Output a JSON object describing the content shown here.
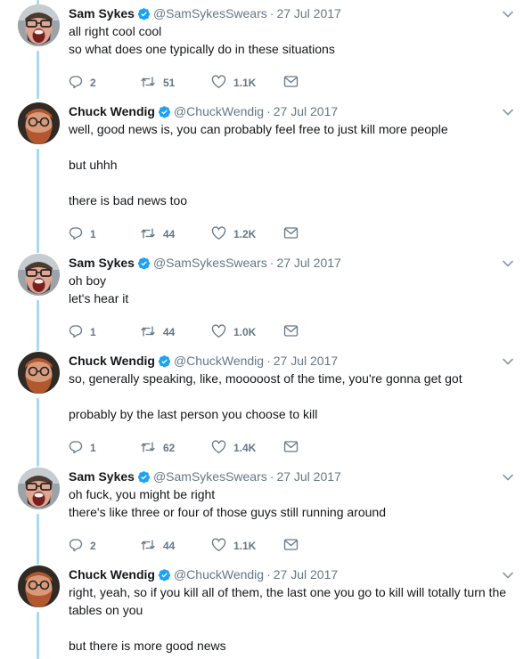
{
  "tweets": [
    {
      "name": "Sam Sykes",
      "handle": "@SamSykesSwears",
      "date": "27 Jul 2017",
      "avatar": "sam-avatar",
      "lines": [
        "all right cool cool",
        "so what does one typically do in these situations"
      ],
      "replies": "2",
      "retweets": "51",
      "likes": "1.1K"
    },
    {
      "name": "Chuck Wendig",
      "handle": "@ChuckWendig",
      "date": "27 Jul 2017",
      "avatar": "chuck-avatar",
      "lines": [
        "well, good news is, you can probably feel free to just kill more people",
        "",
        "but uhhh",
        "",
        "there is bad news too"
      ],
      "replies": "1",
      "retweets": "44",
      "likes": "1.2K"
    },
    {
      "name": "Sam Sykes",
      "handle": "@SamSykesSwears",
      "date": "27 Jul 2017",
      "avatar": "sam-avatar",
      "lines": [
        "oh boy",
        "let's hear it"
      ],
      "replies": "1",
      "retweets": "44",
      "likes": "1.0K"
    },
    {
      "name": "Chuck Wendig",
      "handle": "@ChuckWendig",
      "date": "27 Jul 2017",
      "avatar": "chuck-avatar",
      "lines": [
        "so, generally speaking, like, mooooost of the time, you're gonna get got",
        "",
        "probably by the last person you choose to kill"
      ],
      "replies": "1",
      "retweets": "62",
      "likes": "1.4K"
    },
    {
      "name": "Sam Sykes",
      "handle": "@SamSykesSwears",
      "date": "27 Jul 2017",
      "avatar": "sam-avatar",
      "lines": [
        "oh fuck, you might be right",
        "there's like three or four of those guys still running around"
      ],
      "replies": "2",
      "retweets": "44",
      "likes": "1.1K"
    },
    {
      "name": "Chuck Wendig",
      "handle": "@ChuckWendig",
      "date": "27 Jul 2017",
      "avatar": "chuck-avatar",
      "lines": [
        "right, yeah, so if you kill all of them, the last one you go to kill will totally turn the",
        "tables on you",
        "",
        "but there is more good news"
      ],
      "replies": null,
      "retweets": null,
      "likes": null
    }
  ],
  "colors": {
    "thread_line": "#a6dcf3",
    "verified": "#1da1f2",
    "meta": "#657786",
    "text": "#14171a"
  },
  "icons": {
    "reply": "reply-icon",
    "retweet": "retweet-icon",
    "like": "heart-icon",
    "dm": "envelope-icon",
    "verified": "verified-badge-icon",
    "caret": "chevron-down-icon"
  }
}
